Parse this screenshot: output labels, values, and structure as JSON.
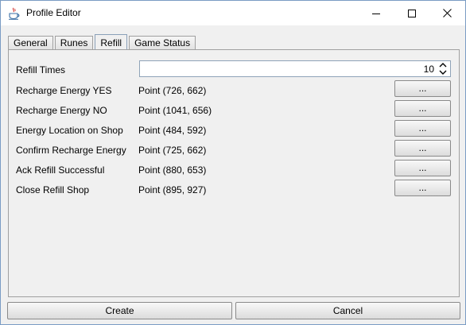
{
  "window": {
    "title": "Profile Editor",
    "app_icon": "java-cup-icon",
    "controls": [
      "minimize-icon",
      "maximize-icon",
      "close-icon"
    ]
  },
  "tabs": [
    {
      "label": "General",
      "active": false
    },
    {
      "label": "Runes",
      "active": false
    },
    {
      "label": "Refill",
      "active": true
    },
    {
      "label": "Game Status",
      "active": false
    }
  ],
  "refill_times": {
    "label": "Refill Times",
    "value": "10"
  },
  "rows": [
    {
      "label": "Recharge Energy YES",
      "value": "Point (726, 662)",
      "button": "..."
    },
    {
      "label": "Recharge Energy NO",
      "value": "Point (1041, 656)",
      "button": "..."
    },
    {
      "label": "Energy Location on Shop",
      "value": "Point (484, 592)",
      "button": "..."
    },
    {
      "label": "Confirm Recharge Energy",
      "value": "Point (725, 662)",
      "button": "..."
    },
    {
      "label": "Ack Refill Successful",
      "value": "Point (880, 653)",
      "button": "..."
    },
    {
      "label": "Close Refill Shop",
      "value": "Point (895, 927)",
      "button": "..."
    }
  ],
  "actions": {
    "create": "Create",
    "cancel": "Cancel"
  }
}
